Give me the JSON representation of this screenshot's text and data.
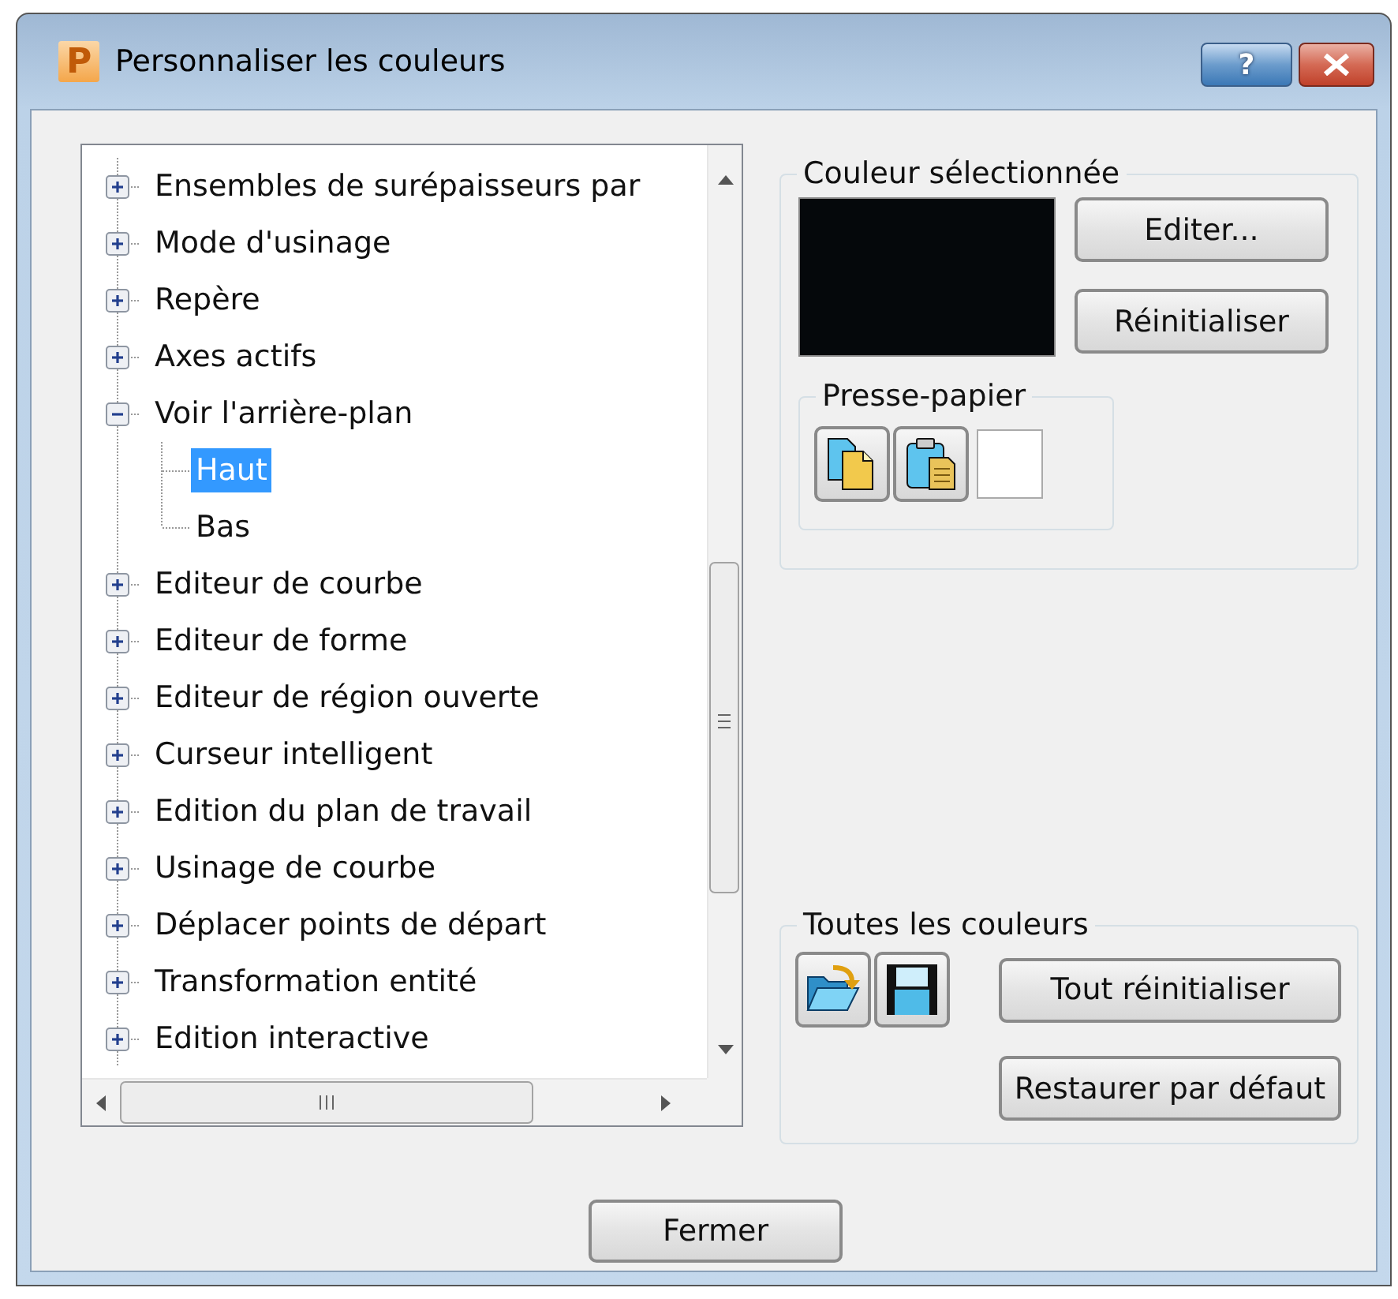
{
  "window": {
    "title": "Personnaliser les couleurs",
    "app_icon_letter": "P",
    "help_label": "?"
  },
  "tree": {
    "items": [
      {
        "label": "Ensembles de surépaisseurs par",
        "expanded": false,
        "selected": false
      },
      {
        "label": "Mode d'usinage",
        "expanded": false,
        "selected": false
      },
      {
        "label": "Repère",
        "expanded": false,
        "selected": false
      },
      {
        "label": "Axes actifs",
        "expanded": false,
        "selected": false
      },
      {
        "label": "Voir l'arrière-plan",
        "expanded": true,
        "selected": false,
        "children": [
          {
            "label": "Haut",
            "selected": true
          },
          {
            "label": "Bas",
            "selected": false
          }
        ]
      },
      {
        "label": "Editeur de courbe",
        "expanded": false,
        "selected": false
      },
      {
        "label": "Editeur de forme",
        "expanded": false,
        "selected": false
      },
      {
        "label": "Editeur de région ouverte",
        "expanded": false,
        "selected": false
      },
      {
        "label": "Curseur intelligent",
        "expanded": false,
        "selected": false
      },
      {
        "label": "Edition du plan de travail",
        "expanded": false,
        "selected": false
      },
      {
        "label": "Usinage de courbe",
        "expanded": false,
        "selected": false
      },
      {
        "label": "Déplacer points de départ",
        "expanded": false,
        "selected": false
      },
      {
        "label": "Transformation entité",
        "expanded": false,
        "selected": false
      },
      {
        "label": "Edition interactive",
        "expanded": false,
        "selected": false
      }
    ]
  },
  "selected_color": {
    "title": "Couleur sélectionnée",
    "buttons": [
      "Editer...",
      "Réinitialiser"
    ],
    "clipboard": {
      "title": "Presse-papier"
    }
  },
  "all_colors": {
    "title": "Toutes les couleurs",
    "buttons": [
      "Tout réinitialiser",
      "Restaurer par défaut"
    ]
  },
  "footer": {
    "close_button": "Fermer"
  }
}
